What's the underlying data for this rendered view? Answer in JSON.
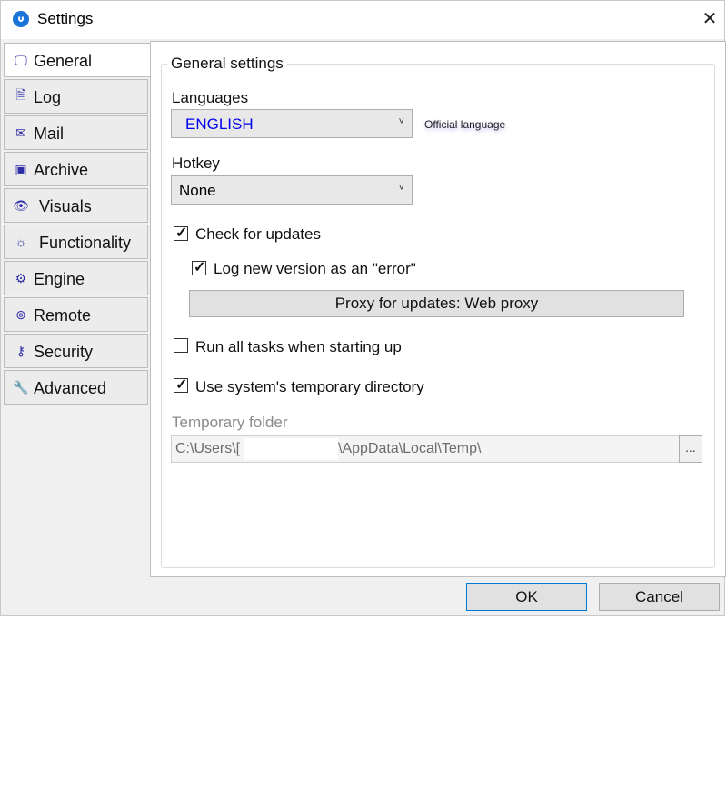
{
  "window": {
    "title": "Settings",
    "close_glyph": "✕"
  },
  "tabs": [
    {
      "label": "General",
      "icon": "monitor-icon",
      "glyph": "🖵",
      "active": true
    },
    {
      "label": "Log",
      "icon": "document-icon",
      "glyph": "🗎",
      "active": false
    },
    {
      "label": "Mail",
      "icon": "envelope-icon",
      "glyph": "✉",
      "active": false
    },
    {
      "label": "Archive",
      "icon": "archive-box-icon",
      "glyph": "▣",
      "active": false
    },
    {
      "label": "Visuals",
      "icon": "eye-icon",
      "glyph": "👁",
      "active": false
    },
    {
      "label": "Functionality",
      "icon": "lightbulb-icon",
      "glyph": "☼",
      "active": false
    },
    {
      "label": "Engine",
      "icon": "gears-icon",
      "glyph": "⚙",
      "active": false
    },
    {
      "label": "Remote",
      "icon": "antenna-icon",
      "glyph": "⊚",
      "active": false
    },
    {
      "label": "Security",
      "icon": "key-icon",
      "glyph": "⚷",
      "active": false
    },
    {
      "label": "Advanced",
      "icon": "wrench-icon",
      "glyph": "🔧",
      "active": false
    }
  ],
  "general": {
    "group_title": "General settings",
    "languages_label": "Languages",
    "language_value": "ENGLISH",
    "language_value_color": "#0000ee",
    "official_language_note": "Official language",
    "hotkey_label": "Hotkey",
    "hotkey_value": "None",
    "dropdown_arrow": "˅",
    "check_updates_label": "Check for updates",
    "check_updates_checked": true,
    "log_new_version_label": "Log new version as an \"error\"",
    "log_new_version_checked": true,
    "proxy_button_label": "Proxy for updates: Web proxy",
    "run_tasks_label": "Run all tasks when starting up",
    "run_tasks_checked": false,
    "use_temp_dir_label": "Use system's temporary directory",
    "use_temp_dir_checked": true,
    "temp_folder_label": "Temporary folder",
    "temp_folder_prefix": "C:\\Users\\[",
    "temp_folder_suffix": "\\AppData\\Local\\Temp\\",
    "browse_label": "..."
  },
  "buttons": {
    "ok": "OK",
    "cancel": "Cancel"
  },
  "check_glyph": "✓"
}
